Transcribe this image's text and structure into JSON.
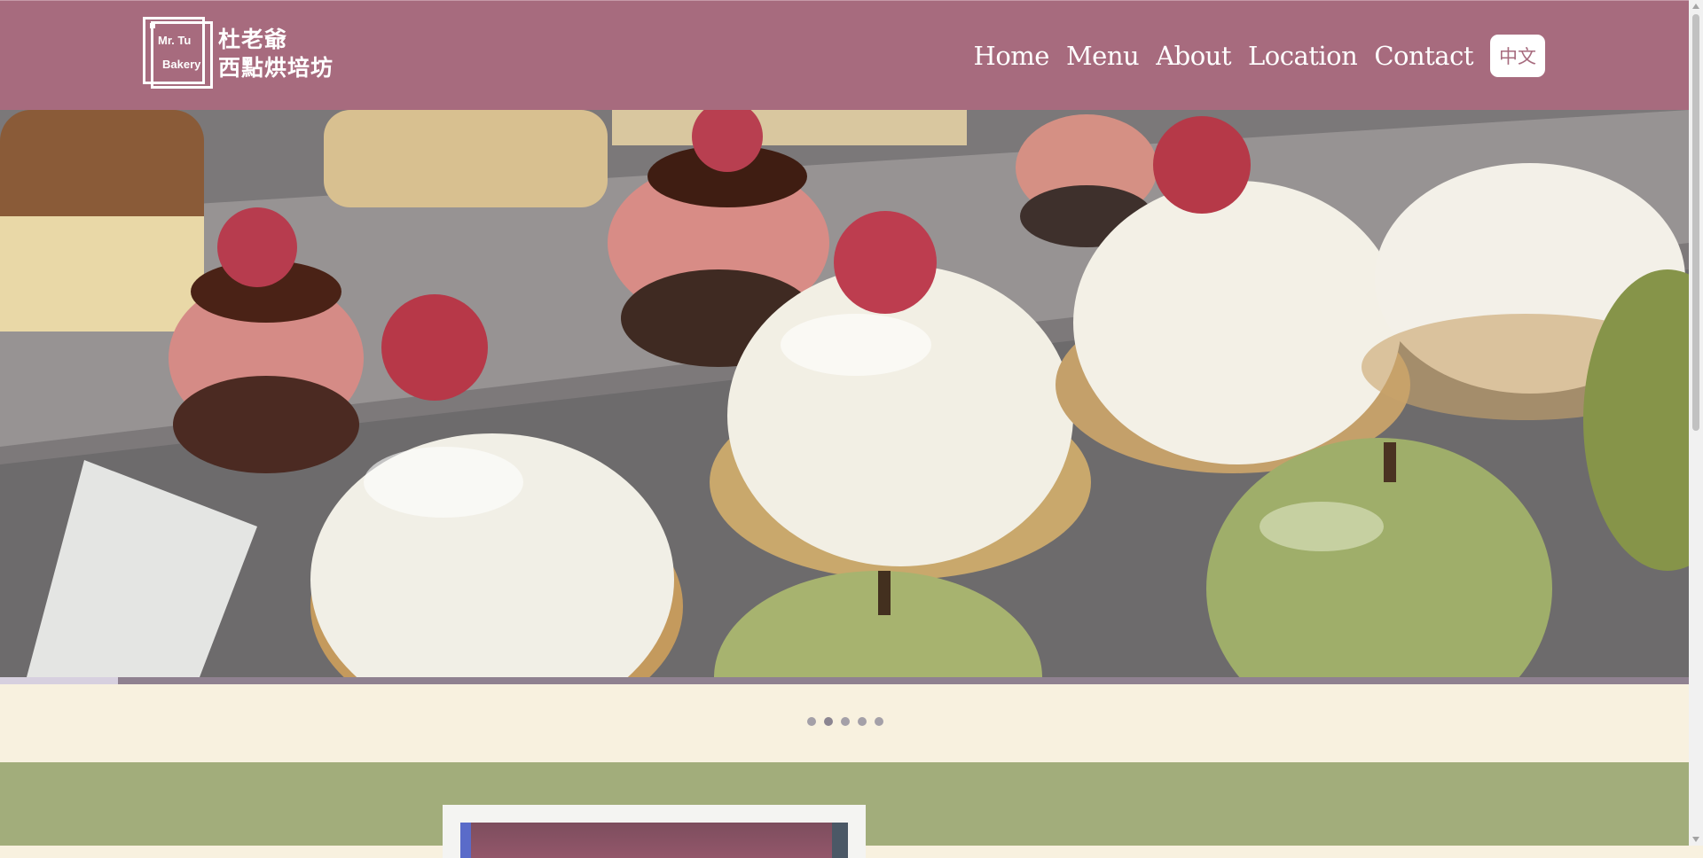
{
  "brand": {
    "logo_en_line1": "Mr. Tu",
    "logo_en_line2": "Bakery",
    "logo_zh_line1": "杜老爺",
    "logo_zh_line2": "西點烘培坊"
  },
  "nav": {
    "items": [
      {
        "label": "Home"
      },
      {
        "label": "Menu"
      },
      {
        "label": "About"
      },
      {
        "label": "Location"
      },
      {
        "label": "Contact"
      }
    ],
    "language_button": "中文"
  },
  "hero": {
    "image": "pastry-display-photo",
    "slide_count": 5,
    "active_slide": 2,
    "progress": 0.07
  },
  "colors": {
    "header": "#a76b7e",
    "cream": "#f8f1df",
    "green": "#a2ad7b"
  }
}
